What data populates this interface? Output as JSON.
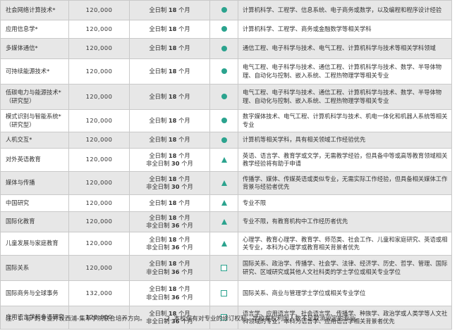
{
  "programs": [
    {
      "name": "社会网络计算技术*",
      "fee": "120,000",
      "durations": [
        {
          "prefix": "全日制",
          "num": "18",
          "unit": "个月"
        }
      ],
      "mark": "dot",
      "mark_icon": "filled-circle-icon",
      "requirement": "计算机科学、工程学、信息系统、电子商务或数学，以及编程和程序设计经验"
    },
    {
      "name": "应用信息学*",
      "fee": "120,000",
      "durations": [
        {
          "prefix": "全日制",
          "num": "18",
          "unit": "个月"
        }
      ],
      "mark": "dot",
      "mark_icon": "filled-circle-icon",
      "requirement": "计算机科学、工程学、商务或金融数学等相关学科"
    },
    {
      "name": "多媒体通信*",
      "fee": "120,000",
      "durations": [
        {
          "prefix": "全日制",
          "num": "18",
          "unit": "个月"
        }
      ],
      "mark": "dot",
      "mark_icon": "filled-circle-icon",
      "requirement": "通信工程、电子科学与技术、电气工程、计算机科学与技术等相关学科领域"
    },
    {
      "name": "可持续能源技术*",
      "fee": "120,000",
      "durations": [
        {
          "prefix": "全日制",
          "num": "18",
          "unit": "个月"
        }
      ],
      "mark": "dot",
      "mark_icon": "filled-circle-icon",
      "requirement": "电气工程、电子科学与技术、通信工程、计算机科学与技术、数学、半导体物理、自动化与控制、嵌入系统、工程热物理学等相关专业"
    },
    {
      "name": "低碳电力与能源技术*（研究型）",
      "fee": "120,000",
      "durations": [
        {
          "prefix": "全日制",
          "num": "18",
          "unit": "个月"
        }
      ],
      "mark": "dot",
      "mark_icon": "filled-circle-icon",
      "requirement": "电气工程、电子科学与技术、通信工程、计算机科学与技术、数学、半导体物理、自动化与控制、嵌入系统、工程热物理学等相关专业"
    },
    {
      "name": "模式识别与智能系统*（研究型）",
      "fee": "120,000",
      "durations": [
        {
          "prefix": "全日制",
          "num": "18",
          "unit": "个月"
        }
      ],
      "mark": "dot",
      "mark_icon": "filled-circle-icon",
      "requirement": "数字媒体技术、电气工程、计算机科学与技术、机电一体化和机器人系统等相关专业"
    },
    {
      "name": "人机交互*",
      "fee": "120,000",
      "durations": [
        {
          "prefix": "全日制",
          "num": "18",
          "unit": "个月"
        }
      ],
      "mark": "dot",
      "mark_icon": "filled-circle-icon",
      "requirement": "计算机等相关学科，具有相关领域工作经验优先"
    },
    {
      "name": "对外英语教育",
      "fee": "120,000",
      "durations": [
        {
          "prefix": "全日制",
          "num": "18",
          "unit": "个月"
        },
        {
          "prefix": "非全日制",
          "num": "30",
          "unit": "个月"
        }
      ],
      "mark": "tri",
      "mark_icon": "filled-triangle-icon",
      "requirement": "英语、语言学、教育学或文学，无需教学经验，但具备中等或高等教育领域相关教学经验将有助于申请"
    },
    {
      "name": "媒体与传播",
      "fee": "120,000",
      "durations": [
        {
          "prefix": "全日制",
          "num": "18",
          "unit": "个月"
        },
        {
          "prefix": "非全日制",
          "num": "30",
          "unit": "个月"
        }
      ],
      "mark": "tri",
      "mark_icon": "filled-triangle-icon",
      "requirement": "传播学、媒体、传媒英语或类似专业，无需实际工作经验，但具备相关媒体工作背景与经验者优先"
    },
    {
      "name": "中国研究",
      "fee": "120,000",
      "durations": [
        {
          "prefix": "全日制",
          "num": "18",
          "unit": "个月"
        }
      ],
      "mark": "tri",
      "mark_icon": "filled-triangle-icon",
      "requirement": "专业不限"
    },
    {
      "name": "国际化教育",
      "fee": "120,000",
      "durations": [
        {
          "prefix": "全日制",
          "num": "18",
          "unit": "个月"
        },
        {
          "prefix": "非全日制",
          "num": "36",
          "unit": "个月"
        }
      ],
      "mark": "tri",
      "mark_icon": "filled-triangle-icon",
      "requirement": "专业不限，有教育机构中工作经历者优先"
    },
    {
      "name": "儿童发展与家庭教育",
      "fee": "120,000",
      "durations": [
        {
          "prefix": "全日制",
          "num": "18",
          "unit": "个月"
        },
        {
          "prefix": "非全日制",
          "num": "36",
          "unit": "个月"
        }
      ],
      "mark": "tri",
      "mark_icon": "filled-triangle-icon",
      "requirement": "心理学、教育心理学、教育学、师范类、社会工作、儿童和家庭研究、英语或相关专业，本科为心理学或教育相关背景者优先"
    },
    {
      "name": "国际关系",
      "fee": "120,000",
      "durations": [
        {
          "prefix": "全日制",
          "num": "18",
          "unit": "个月"
        },
        {
          "prefix": "非全日制",
          "num": "36",
          "unit": "个月"
        }
      ],
      "mark": "sq",
      "mark_icon": "hollow-square-icon",
      "requirement": "国际关系、政治学、传播学、社会学、法律、经济学、历史、哲学、管理、国际研究、区域研究或其他人文社科类的学士学位或相关专业学位"
    },
    {
      "name": "国际商务与全球事务",
      "fee": "132,000",
      "durations": [
        {
          "prefix": "全日制",
          "num": "18",
          "unit": "个月"
        },
        {
          "prefix": "非全日制",
          "num": "36",
          "unit": "个月"
        }
      ],
      "mark": "sq",
      "mark_icon": "hollow-square-icon",
      "requirement": "国际关系、商业与管理学士学位或相关专业学位"
    },
    {
      "name": "应用语言学和多语研究",
      "fee": "120,000",
      "durations": [
        {
          "prefix": "全日制",
          "num": "18",
          "unit": "个月"
        },
        {
          "prefix": "非全日制",
          "num": "36",
          "unit": "个月"
        }
      ],
      "mark": "sq",
      "mark_icon": "hollow-square-icon",
      "requirement": "语言学、应用语言学、社会语言学、传播学、种族学、政治学或人类学等人文社科领域的专业，本科为语言学、应用语言学相关背景者优先"
    }
  ],
  "footnotes": [
    "注：1. 标*的专业开设西浦-集萃学院联合培养方向。",
    "2. 本校保有对专业的修订权利，学校有权利因人数不足取消设定的专业。"
  ]
}
